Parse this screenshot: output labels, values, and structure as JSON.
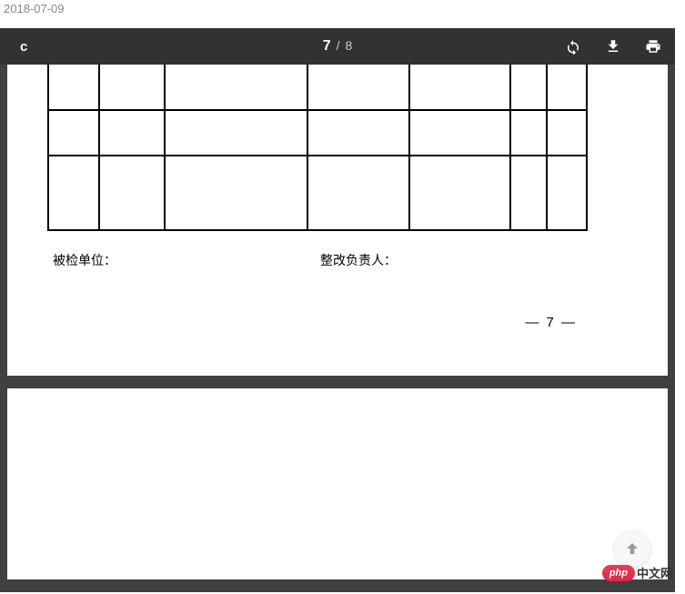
{
  "header": {
    "date": "2018-07-09"
  },
  "viewer": {
    "title": "c",
    "current_page": "7",
    "separator": "/",
    "total_pages": "8"
  },
  "document": {
    "signature_left": "被检单位：",
    "signature_right": "整改负责人：",
    "page_number_display": "— 7 —"
  },
  "watermark": {
    "brand": "php",
    "text": "中文网"
  }
}
